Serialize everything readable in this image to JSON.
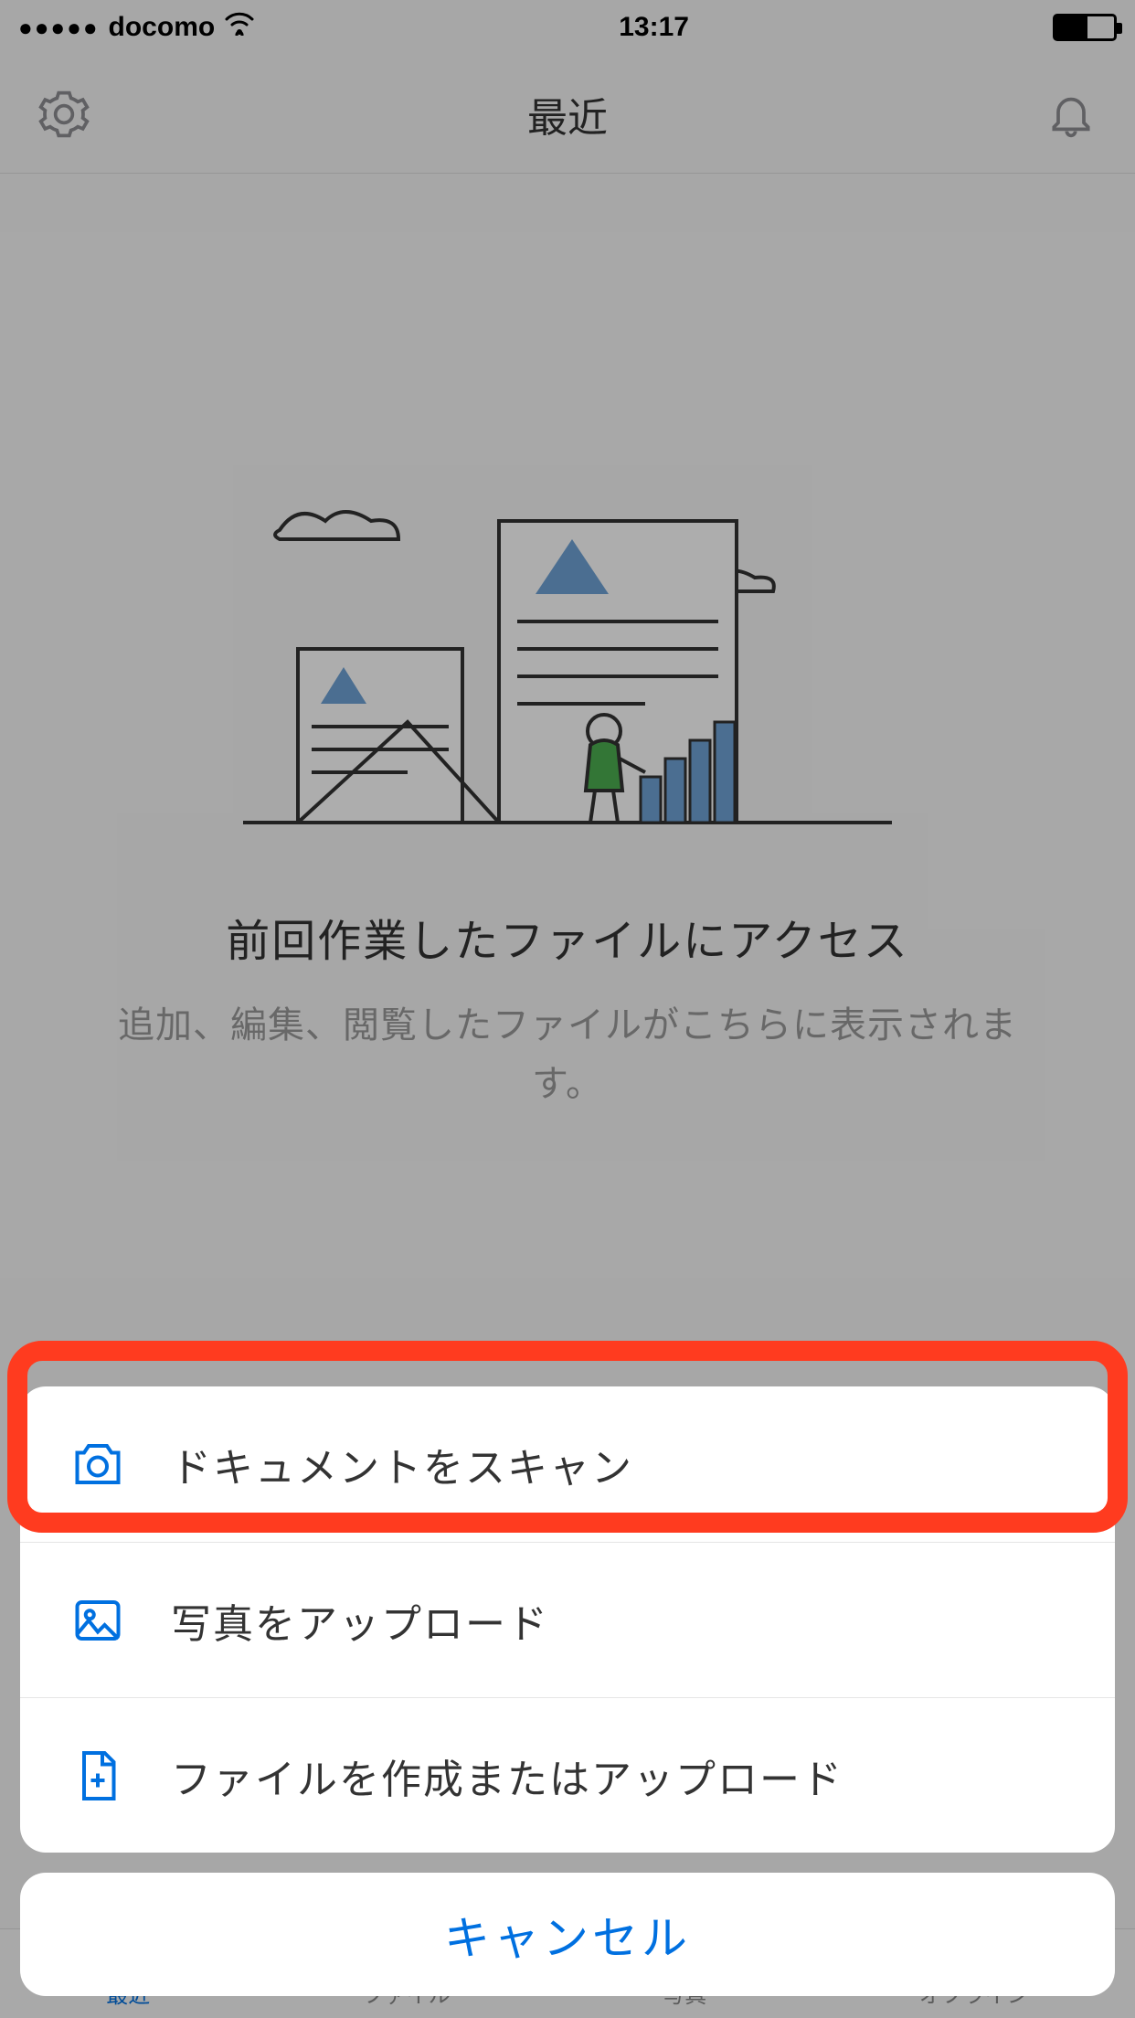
{
  "status": {
    "carrier": "docomo",
    "time": "13:17"
  },
  "nav": {
    "title": "最近"
  },
  "empty": {
    "title": "前回作業したファイルにアクセス",
    "subtitle": "追加、編集、閲覧したファイルがこちらに表示されます。"
  },
  "sheet": {
    "items": [
      {
        "icon": "camera-icon",
        "label": "ドキュメントをスキャン"
      },
      {
        "icon": "photo-icon",
        "label": "写真をアップロード"
      },
      {
        "icon": "file-plus-icon",
        "label": "ファイルを作成またはアップロード"
      }
    ],
    "cancel": "キャンセル"
  },
  "tabs": [
    {
      "label": "最近",
      "active": true
    },
    {
      "label": "ファイル",
      "active": false
    },
    {
      "label": "写真",
      "active": false
    },
    {
      "label": "オフライン",
      "active": false
    }
  ],
  "colors": {
    "accent": "#0070e0",
    "highlight": "#ff3b1f"
  }
}
